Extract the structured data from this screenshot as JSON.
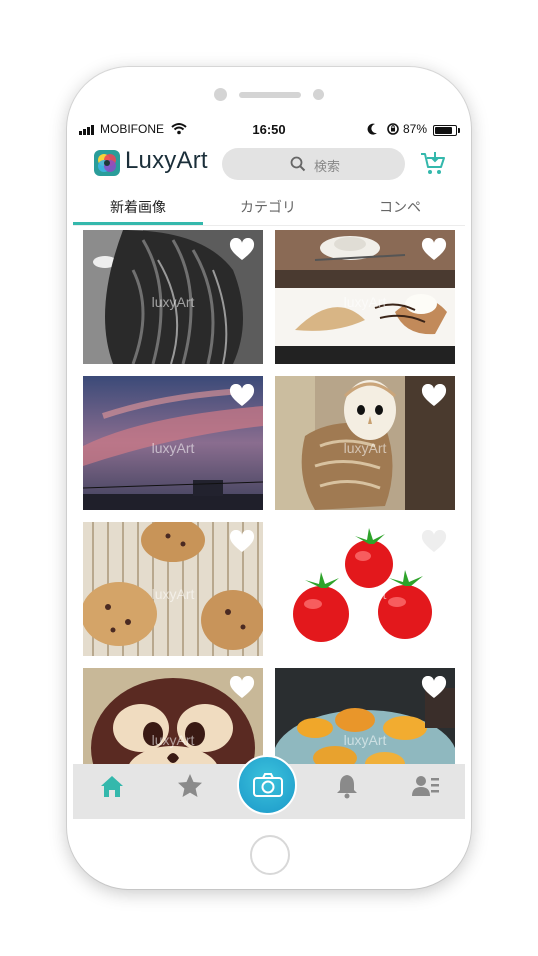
{
  "status": {
    "carrier": "MOBIFONE",
    "time": "16:50",
    "battery": "87%",
    "battery_level": 0.87
  },
  "header": {
    "app_name": "LuxyArt",
    "search_placeholder": "検索",
    "icons": [
      "app-logo",
      "search-icon",
      "cart-icon"
    ]
  },
  "tabs": [
    {
      "label": "新着画像",
      "active": true
    },
    {
      "label": "カテゴリ",
      "active": false
    },
    {
      "label": "コンペ",
      "active": false
    }
  ],
  "watermark": "luxyArt",
  "photos": [
    {
      "subject": "hair",
      "liked": false
    },
    {
      "subject": "crepe-dessert",
      "liked": false
    },
    {
      "subject": "sunset-sky",
      "liked": false
    },
    {
      "subject": "owl",
      "liked": false
    },
    {
      "subject": "bread",
      "liked": false
    },
    {
      "subject": "tomatoes",
      "liked": false
    },
    {
      "subject": "character-bread",
      "liked": false
    },
    {
      "subject": "sea-urchin",
      "liked": false
    }
  ],
  "bottom_nav": [
    {
      "icon": "home-icon",
      "active": true
    },
    {
      "icon": "star-icon",
      "active": false
    },
    {
      "icon": "camera-icon",
      "active": false
    },
    {
      "icon": "bell-icon",
      "active": false
    },
    {
      "icon": "profile-list-icon",
      "active": false
    }
  ],
  "colors": {
    "accent": "#34b8ac",
    "camera_button": "#1b98c9",
    "nav_inactive": "#8a8a8a",
    "nav_active": "#34b8ac"
  }
}
